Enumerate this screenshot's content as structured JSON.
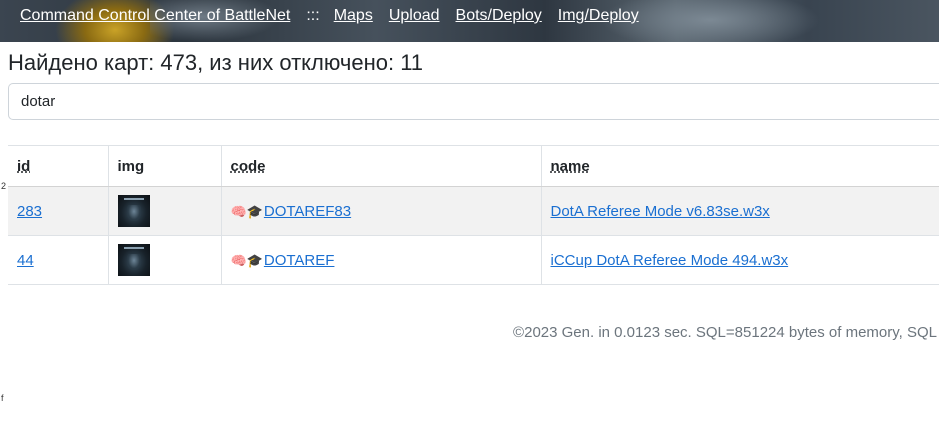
{
  "nav": {
    "items": [
      {
        "label": "Command Control Center of BattleNet"
      },
      {
        "label": "Maps"
      },
      {
        "label": "Upload"
      },
      {
        "label": "Bots/Deploy"
      },
      {
        "label": "Img/Deploy"
      }
    ],
    "separator": ":::"
  },
  "heading": "Найдено карт: 473, из них отключено: 11",
  "search": {
    "value": "dotar"
  },
  "table": {
    "headers": [
      "id",
      "img",
      "code",
      "name"
    ],
    "rows": [
      {
        "id": "283",
        "badges": "🧠🎓",
        "code": "DOTAREF83",
        "name": "DotA Referee Mode v6.83se.w3x"
      },
      {
        "id": "44",
        "badges": "🧠🎓",
        "code": "DOTAREF",
        "name": "iCCup DotA Referee Mode 494.w3x"
      }
    ]
  },
  "footer": "©2023 Gen. in 0.0123 sec. SQL=851224 bytes of memory, SQL",
  "edge_glyphs": [
    "2",
    "f"
  ],
  "colors": {
    "link": "#1a6fd1",
    "stripe": "#f2f2f2",
    "muted": "#6c757d"
  }
}
